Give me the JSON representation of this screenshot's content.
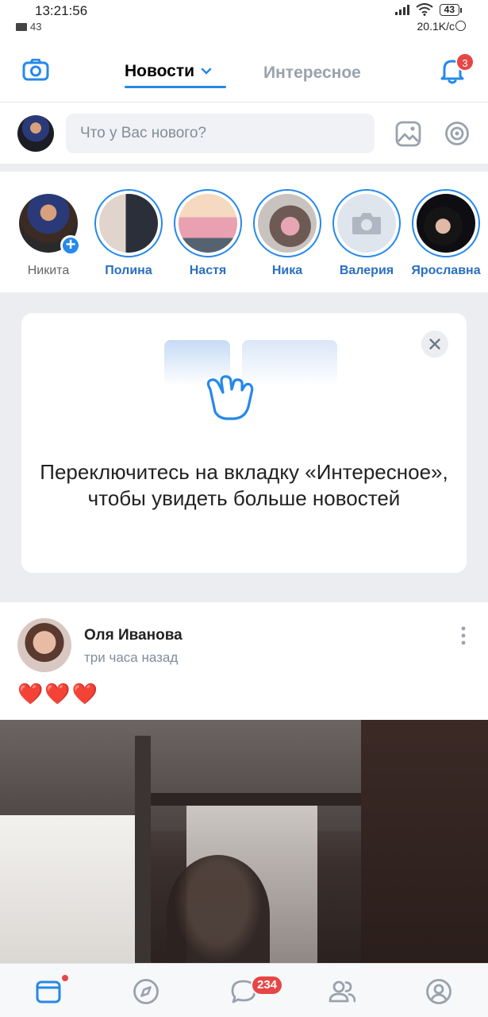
{
  "status_bar": {
    "time": "13:21:56",
    "mail_count": "43",
    "battery": "43",
    "speed": "20.1K/c"
  },
  "header": {
    "tab_active": "Новости",
    "tab_inactive": "Интересное",
    "notifications_badge": "3"
  },
  "composer": {
    "placeholder": "Что у Вас нового?"
  },
  "stories": [
    {
      "name": "Никита"
    },
    {
      "name": "Полина"
    },
    {
      "name": "Настя"
    },
    {
      "name": "Ника"
    },
    {
      "name": "Валерия"
    },
    {
      "name": "Ярославна"
    }
  ],
  "promo": {
    "text": "Переключитесь на вкладку «Интересное», чтобы увидеть больше новостей"
  },
  "post": {
    "author": "Оля Иванова",
    "time": "три часа назад",
    "text": "❤️❤️❤️"
  },
  "bottom_nav": {
    "messages_badge": "234"
  },
  "colors": {
    "accent": "#2688eb",
    "badge": "#e64646",
    "secondary_text": "#818c99"
  }
}
